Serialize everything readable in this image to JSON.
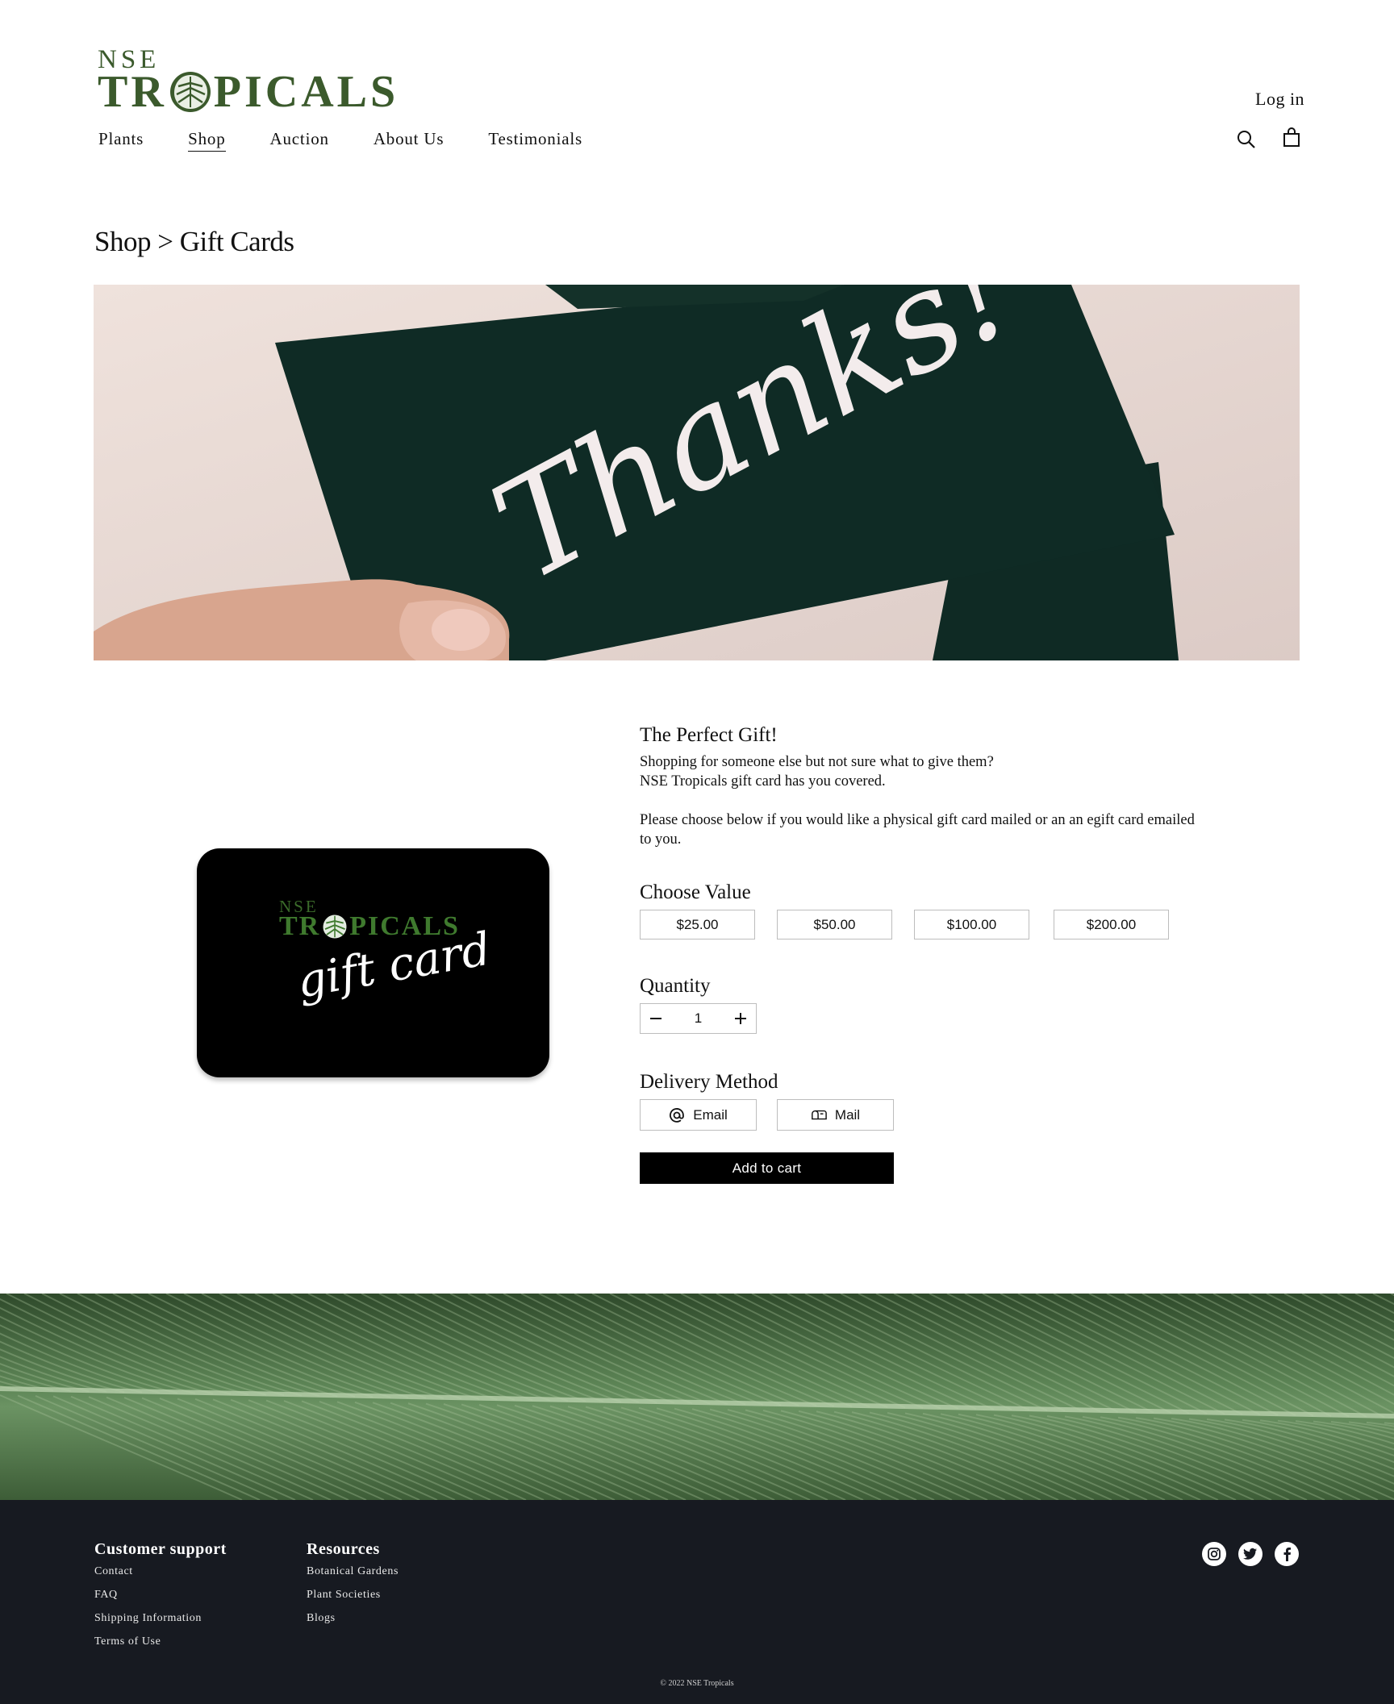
{
  "brand": {
    "line1": "NSE",
    "line2_pre": "TR",
    "line2_post": "PICALS",
    "brand_green": "#3b5a2c"
  },
  "header": {
    "login_label": "Log in",
    "nav": [
      "Plants",
      "Shop",
      "Auction",
      "About Us",
      "Testimonials"
    ],
    "active_nav": "Shop",
    "icons": [
      "search-icon",
      "shopping-bag-icon"
    ]
  },
  "breadcrumb": "Shop > Gift Cards",
  "hero": {
    "script_text": "Thanks!"
  },
  "gift_card": {
    "line1": "NSE",
    "line2_pre": "TR",
    "line2_post": "PICALS",
    "script": "gift card"
  },
  "product": {
    "heading": "The Perfect Gift!",
    "description_line1": "Shopping for someone else but not sure what to give them?",
    "description_line2": "NSE Tropicals gift card has you covered.",
    "description_line3": "Please choose below if you would like a physical gift card mailed or an an egift card emailed to you.",
    "value_heading": "Choose Value",
    "values": [
      "$25.00",
      "$50.00",
      "$100.00",
      "$200.00"
    ],
    "quantity_heading": "Quantity",
    "quantity_value": "1",
    "delivery_heading": "Delivery Method",
    "delivery_options": [
      {
        "label": "Email",
        "icon": "at-sign-icon"
      },
      {
        "label": "Mail",
        "icon": "mailbox-icon"
      }
    ],
    "add_to_cart_label": "Add to cart"
  },
  "footer": {
    "col1_title": "Customer support",
    "col1_links": [
      "Contact",
      "FAQ",
      "Shipping Information",
      "Terms of Use"
    ],
    "col2_title": "Resources",
    "col2_links": [
      "Botanical Gardens",
      "Plant Societies",
      "Blogs"
    ],
    "social": [
      "instagram-icon",
      "twitter-icon",
      "facebook-icon"
    ],
    "copyright": "© 2022 NSE Tropicals",
    "background": "#171a21"
  }
}
